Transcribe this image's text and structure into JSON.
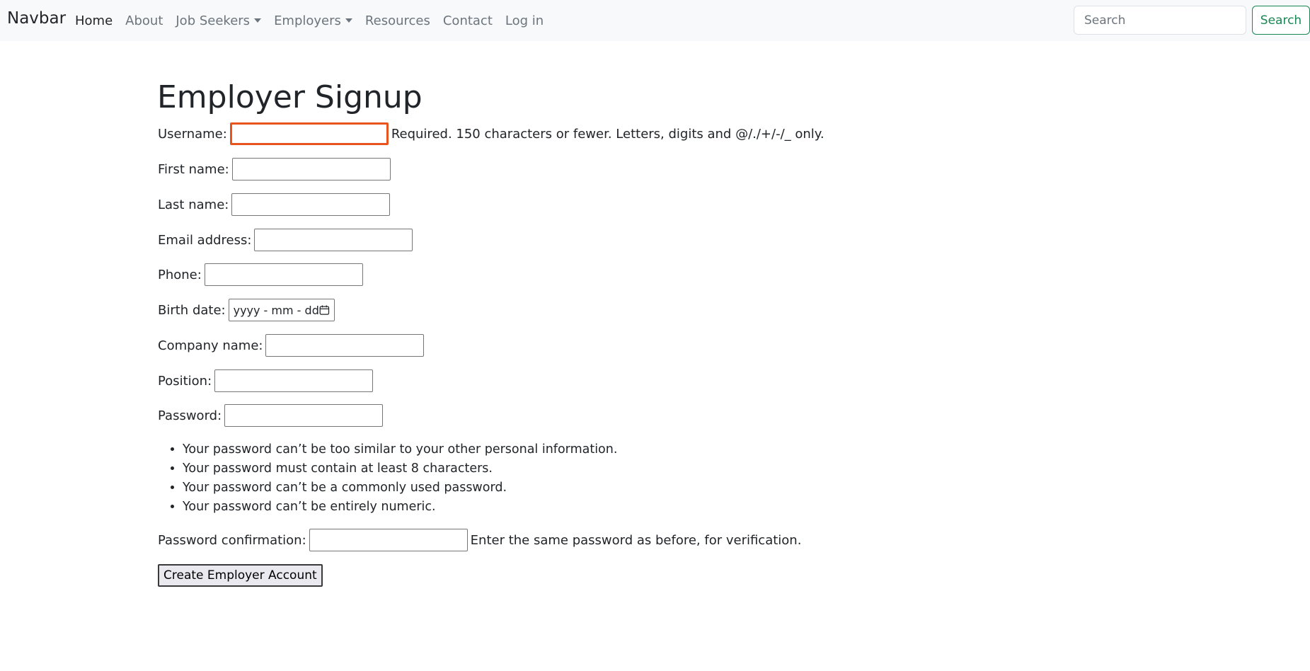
{
  "navbar": {
    "brand": "Navbar",
    "links": {
      "home": "Home",
      "about": "About",
      "job_seekers": "Job Seekers",
      "employers": "Employers",
      "resources": "Resources",
      "contact": "Contact",
      "login": "Log in"
    },
    "search_placeholder": "Search",
    "search_button": "Search"
  },
  "page": {
    "title": "Employer Signup",
    "fields": {
      "username": {
        "label": "Username:",
        "value": "",
        "help": "Required. 150 characters or fewer. Letters, digits and @/./+/-/_ only."
      },
      "first_name": {
        "label": "First name:",
        "value": ""
      },
      "last_name": {
        "label": "Last name:",
        "value": ""
      },
      "email": {
        "label": "Email address:",
        "value": ""
      },
      "phone": {
        "label": "Phone:",
        "value": ""
      },
      "birth_date": {
        "label": "Birth date:",
        "placeholder": "yyyy - mm - dd"
      },
      "company_name": {
        "label": "Company name:",
        "value": ""
      },
      "position": {
        "label": "Position:",
        "value": ""
      },
      "password": {
        "label": "Password:",
        "value": ""
      },
      "password_confirmation": {
        "label": "Password confirmation:",
        "value": "",
        "help": "Enter the same password as before, for verification."
      }
    },
    "password_rules": [
      "Your password can’t be too similar to your other personal information.",
      "Your password must contain at least 8 characters.",
      "Your password can’t be a commonly used password.",
      "Your password can’t be entirely numeric."
    ],
    "submit_button": "Create Employer Account"
  },
  "colors": {
    "navbar_bg": "#f8f9fa",
    "search_button": "#198754",
    "focus_ring": "#e8541e"
  }
}
